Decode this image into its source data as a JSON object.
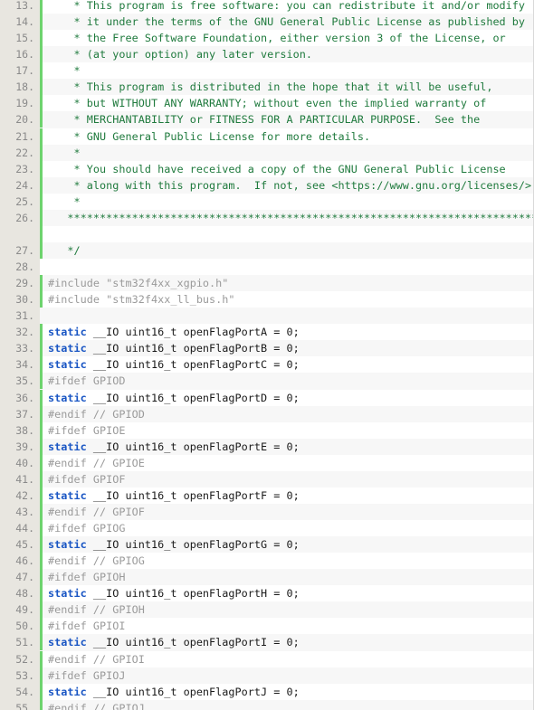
{
  "editor": {
    "gutter_bg": "#e8e6e0",
    "line_number_color": "#8a8a8a",
    "marker_color": "#6ed36e",
    "row_alt_bg": "#f7f7f7",
    "row_bg": "#ffffff",
    "comment_color": "#1f7a3d",
    "preprocessor_color": "#9a9a9a",
    "keyword_color": "#1a56c4",
    "text_color": "#1a1a1a",
    "first_visible_line": 13,
    "last_visible_line": 55,
    "language": "C"
  },
  "lines": [
    {
      "num": "13.",
      "marker": true,
      "tokens": [
        {
          "t": "comment",
          "v": "    * This program is free software: you can redistribute it and/or modify"
        }
      ]
    },
    {
      "num": "14.",
      "marker": true,
      "tokens": [
        {
          "t": "comment",
          "v": "    * it under the terms of the GNU General Public License as published by"
        }
      ]
    },
    {
      "num": "15.",
      "marker": true,
      "tokens": [
        {
          "t": "comment",
          "v": "    * the Free Software Foundation, either version 3 of the License, or"
        }
      ]
    },
    {
      "num": "16.",
      "marker": true,
      "tokens": [
        {
          "t": "comment",
          "v": "    * (at your option) any later version."
        }
      ]
    },
    {
      "num": "17.",
      "marker": true,
      "tokens": [
        {
          "t": "comment",
          "v": "    *"
        }
      ]
    },
    {
      "num": "18.",
      "marker": true,
      "tokens": [
        {
          "t": "comment",
          "v": "    * This program is distributed in the hope that it will be useful,"
        }
      ]
    },
    {
      "num": "19.",
      "marker": true,
      "tokens": [
        {
          "t": "comment",
          "v": "    * but WITHOUT ANY WARRANTY; without even the implied warranty of"
        }
      ]
    },
    {
      "num": "20.",
      "marker": true,
      "tokens": [
        {
          "t": "comment",
          "v": "    * MERCHANTABILITY or FITNESS FOR A PARTICULAR PURPOSE.  See the"
        }
      ]
    },
    {
      "num": "21.",
      "marker": true,
      "tokens": [
        {
          "t": "comment",
          "v": "    * GNU General Public License for more details."
        }
      ]
    },
    {
      "num": "22.",
      "marker": true,
      "tokens": [
        {
          "t": "comment",
          "v": "    *"
        }
      ]
    },
    {
      "num": "23.",
      "marker": true,
      "tokens": [
        {
          "t": "comment",
          "v": "    * You should have received a copy of the GNU General Public License"
        }
      ]
    },
    {
      "num": "24.",
      "marker": true,
      "tokens": [
        {
          "t": "comment",
          "v": "    * along with this program.  If not, see <https://www.gnu.org/licenses/>."
        }
      ]
    },
    {
      "num": "25.",
      "marker": true,
      "tokens": [
        {
          "t": "comment",
          "v": "    *"
        }
      ]
    },
    {
      "num": "26.",
      "marker": true,
      "tokens": [
        {
          "t": "comment",
          "v": "   **************************************************************************"
        }
      ]
    },
    {
      "num": "",
      "marker": true,
      "tokens": [
        {
          "t": "blank",
          "v": " "
        }
      ]
    },
    {
      "num": "27.",
      "marker": true,
      "tokens": [
        {
          "t": "comment",
          "v": "   */"
        }
      ]
    },
    {
      "num": "28.",
      "marker": false,
      "tokens": [
        {
          "t": "blank",
          "v": " "
        }
      ]
    },
    {
      "num": "29.",
      "marker": true,
      "tokens": [
        {
          "t": "pre",
          "v": "#include \"stm32f4xx_xgpio.h\""
        }
      ]
    },
    {
      "num": "30.",
      "marker": true,
      "tokens": [
        {
          "t": "pre",
          "v": "#include \"stm32f4xx_ll_bus.h\""
        }
      ]
    },
    {
      "num": "31.",
      "marker": false,
      "tokens": [
        {
          "t": "blank",
          "v": " "
        }
      ]
    },
    {
      "num": "32.",
      "marker": true,
      "tokens": [
        {
          "t": "kw",
          "v": "static"
        },
        {
          "t": "plain",
          "v": " __IO uint16_t openFlagPortA = 0;"
        }
      ]
    },
    {
      "num": "33.",
      "marker": true,
      "tokens": [
        {
          "t": "kw",
          "v": "static"
        },
        {
          "t": "plain",
          "v": " __IO uint16_t openFlagPortB = 0;"
        }
      ]
    },
    {
      "num": "34.",
      "marker": true,
      "tokens": [
        {
          "t": "kw",
          "v": "static"
        },
        {
          "t": "plain",
          "v": " __IO uint16_t openFlagPortC = 0;"
        }
      ]
    },
    {
      "num": "35.",
      "marker": true,
      "tokens": [
        {
          "t": "pre",
          "v": "#ifdef GPIOD"
        }
      ]
    },
    {
      "num": "36.",
      "marker": true,
      "tokens": [
        {
          "t": "kw",
          "v": "static"
        },
        {
          "t": "plain",
          "v": " __IO uint16_t openFlagPortD = 0;"
        }
      ]
    },
    {
      "num": "37.",
      "marker": true,
      "tokens": [
        {
          "t": "pre",
          "v": "#endif // GPIOD"
        }
      ]
    },
    {
      "num": "38.",
      "marker": true,
      "tokens": [
        {
          "t": "pre",
          "v": "#ifdef GPIOE"
        }
      ]
    },
    {
      "num": "39.",
      "marker": true,
      "tokens": [
        {
          "t": "kw",
          "v": "static"
        },
        {
          "t": "plain",
          "v": " __IO uint16_t openFlagPortE = 0;"
        }
      ]
    },
    {
      "num": "40.",
      "marker": true,
      "tokens": [
        {
          "t": "pre",
          "v": "#endif // GPIOE"
        }
      ]
    },
    {
      "num": "41.",
      "marker": true,
      "tokens": [
        {
          "t": "pre",
          "v": "#ifdef GPIOF"
        }
      ]
    },
    {
      "num": "42.",
      "marker": true,
      "tokens": [
        {
          "t": "kw",
          "v": "static"
        },
        {
          "t": "plain",
          "v": " __IO uint16_t openFlagPortF = 0;"
        }
      ]
    },
    {
      "num": "43.",
      "marker": true,
      "tokens": [
        {
          "t": "pre",
          "v": "#endif // GPIOF"
        }
      ]
    },
    {
      "num": "44.",
      "marker": true,
      "tokens": [
        {
          "t": "pre",
          "v": "#ifdef GPIOG"
        }
      ]
    },
    {
      "num": "45.",
      "marker": true,
      "tokens": [
        {
          "t": "kw",
          "v": "static"
        },
        {
          "t": "plain",
          "v": " __IO uint16_t openFlagPortG = 0;"
        }
      ]
    },
    {
      "num": "46.",
      "marker": true,
      "tokens": [
        {
          "t": "pre",
          "v": "#endif // GPIOG"
        }
      ]
    },
    {
      "num": "47.",
      "marker": true,
      "tokens": [
        {
          "t": "pre",
          "v": "#ifdef GPIOH"
        }
      ]
    },
    {
      "num": "48.",
      "marker": true,
      "tokens": [
        {
          "t": "kw",
          "v": "static"
        },
        {
          "t": "plain",
          "v": " __IO uint16_t openFlagPortH = 0;"
        }
      ]
    },
    {
      "num": "49.",
      "marker": true,
      "tokens": [
        {
          "t": "pre",
          "v": "#endif // GPIOH"
        }
      ]
    },
    {
      "num": "50.",
      "marker": true,
      "tokens": [
        {
          "t": "pre",
          "v": "#ifdef GPIOI"
        }
      ]
    },
    {
      "num": "51.",
      "marker": true,
      "tokens": [
        {
          "t": "kw",
          "v": "static"
        },
        {
          "t": "plain",
          "v": " __IO uint16_t openFlagPortI = 0;"
        }
      ]
    },
    {
      "num": "52.",
      "marker": true,
      "tokens": [
        {
          "t": "pre",
          "v": "#endif // GPIOI"
        }
      ]
    },
    {
      "num": "53.",
      "marker": true,
      "tokens": [
        {
          "t": "pre",
          "v": "#ifdef GPIOJ"
        }
      ]
    },
    {
      "num": "54.",
      "marker": true,
      "tokens": [
        {
          "t": "kw",
          "v": "static"
        },
        {
          "t": "plain",
          "v": " __IO uint16_t openFlagPortJ = 0;"
        }
      ]
    },
    {
      "num": "55.",
      "marker": true,
      "tokens": [
        {
          "t": "pre",
          "v": "#endif // GPIOJ"
        }
      ]
    }
  ]
}
